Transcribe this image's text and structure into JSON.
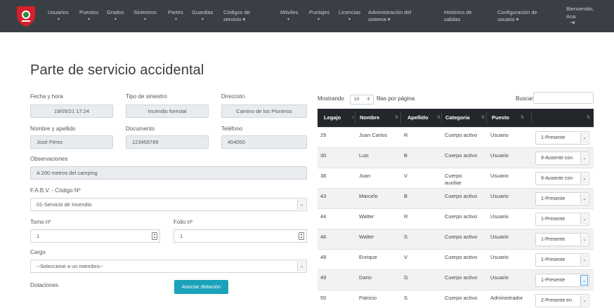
{
  "navbar": {
    "items": [
      {
        "label": "Usuarios",
        "caret": "▾"
      },
      {
        "label": "Puestos",
        "caret": "▾"
      },
      {
        "label": "Grados",
        "caret": "▾"
      },
      {
        "label": "Siniestros",
        "caret": "▾"
      },
      {
        "label": "Partes",
        "caret": "▾"
      },
      {
        "label": "Guardias",
        "caret": "▾"
      },
      {
        "label": "Códigos de",
        "label2": "servicio ▾"
      },
      {
        "label": "Móviles",
        "caret": "▾"
      },
      {
        "label": "Puntajes",
        "caret": "▾"
      },
      {
        "label": "Licencias",
        "caret": "▾"
      },
      {
        "label": "Administración del",
        "label2": "sistema ▾"
      },
      {
        "label": "Histórico de",
        "label2": "salidas"
      },
      {
        "label": "Configuración de",
        "label2": "usuario ▾"
      }
    ],
    "user_line1": "Bienvenido,",
    "user_line2": "Ana",
    "logout_icon": "⇥"
  },
  "page_title": "Parte de servicio accidental",
  "form": {
    "fecha_label": "Fecha y hora",
    "fecha_value": "19/05/21 17:24",
    "tipo_label": "Tipo de siniestro",
    "tipo_value": "Incendio forestal",
    "direccion_label": "Dirección",
    "direccion_value": "Camino de los Pioneros",
    "nombre_label": "Nombre y apellido",
    "nombre_value": "José Pérez",
    "documento_label": "Documento",
    "documento_value": "123456789",
    "telefono_label": "Teléfono",
    "telefono_value": "404050",
    "observaciones_label": "Observaciones",
    "observaciones_value": "A 200 metros del camping",
    "fabv_label": "F.A.B.V. - Código Nº",
    "fabv_value": "01-Servicio de Incendio",
    "tomo_label": "Tomo nº",
    "tomo_value": "1",
    "folio_label": "Folio nº",
    "folio_value": "1",
    "cargo_label": "Cargo",
    "cargo_value": "--Seleccione a un miembro--",
    "dotaciones_label": "Dotaciones",
    "asociar_button": "Asociar dotación"
  },
  "table_controls": {
    "mostrando": "Mostrando",
    "page_size": "10",
    "filas": "filas por página",
    "buscar": "Buscar"
  },
  "table": {
    "headers": [
      "Legajo",
      "Nombre",
      "Apellido",
      "Categoria",
      "Puesto",
      ""
    ],
    "rows": [
      {
        "legajo": "29",
        "nombre": "Juan Carlos",
        "apellido": "R",
        "categoria": "Cuerpo activo",
        "puesto": "Usuario",
        "estado": "1-Presente"
      },
      {
        "legajo": "30",
        "nombre": "Luis",
        "apellido": "B",
        "categoria": "Cuerpo activo",
        "puesto": "Usuario",
        "estado": "9-Ausente con"
      },
      {
        "legajo": "38",
        "nombre": "Juan",
        "apellido": "V",
        "categoria": "Cuerpo auxiliar",
        "puesto": "Usuario",
        "estado": "9-Ausente con"
      },
      {
        "legajo": "43",
        "nombre": "Marcelo",
        "apellido": "B",
        "categoria": "Cuerpo activo",
        "puesto": "Usuario",
        "estado": "1-Presente"
      },
      {
        "legajo": "44",
        "nombre": "Walter",
        "apellido": "R",
        "categoria": "Cuerpo activo",
        "puesto": "Usuario",
        "estado": "1-Presente"
      },
      {
        "legajo": "46",
        "nombre": "Walter",
        "apellido": "S",
        "categoria": "Cuerpo activo",
        "puesto": "Usuario",
        "estado": "1-Presente"
      },
      {
        "legajo": "48",
        "nombre": "Enrique",
        "apellido": "V",
        "categoria": "Cuerpo activo",
        "puesto": "Usuario",
        "estado": "1-Presente"
      },
      {
        "legajo": "49",
        "nombre": "Dario",
        "apellido": "G",
        "categoria": "Cuerpo activo",
        "puesto": "Usuario",
        "estado": "1-Presente"
      },
      {
        "legajo": "50",
        "nombre": "Patricio",
        "apellido": "S",
        "categoria": "Cuerpo activo",
        "puesto": "Administrador",
        "estado": "2-Presente en"
      }
    ]
  },
  "colors": {
    "navbar_bg": "#3a3f45",
    "table_header_bg": "#23272b",
    "button_bg": "#1aa2b9",
    "logo_red": "#d61f2a"
  }
}
